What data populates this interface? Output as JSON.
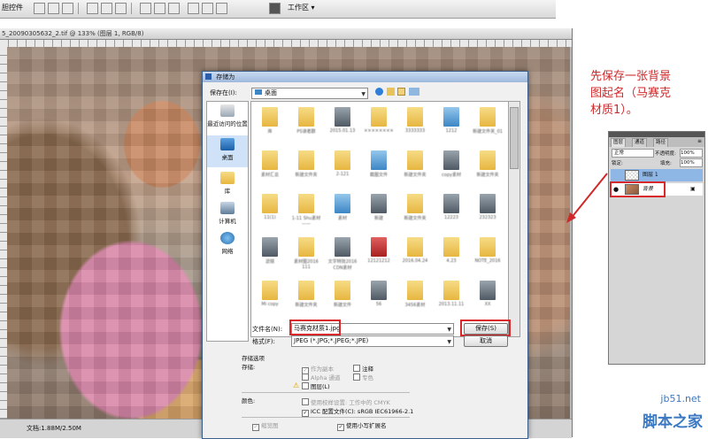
{
  "optbar": {
    "left_label": "胆控件",
    "workspace": "工作区 ▾"
  },
  "document": {
    "title": "5_20090305632_2.tif @ 133% (图层 1, RGB/8)",
    "status": "文档:1.88M/2.50M"
  },
  "dialog": {
    "title": "存储为",
    "save_in_label": "保存在(I):",
    "save_in_value": "桌面",
    "places": [
      {
        "label": "最近访问的位置",
        "icon": "recent-icon"
      },
      {
        "label": "桌面",
        "icon": "desktop-icon"
      },
      {
        "label": "库",
        "icon": "library-icon"
      },
      {
        "label": "计算机",
        "icon": "computer-icon"
      },
      {
        "label": "网络",
        "icon": "network-icon"
      }
    ],
    "files": [
      {
        "label": "库",
        "kind": "folder"
      },
      {
        "label": "PS读者群",
        "kind": "folder"
      },
      {
        "label": "2015.01.13",
        "kind": "doc"
      },
      {
        "label": "××××××××",
        "kind": "folder"
      },
      {
        "label": "3333333",
        "kind": "folder"
      },
      {
        "label": "1212",
        "kind": "blue"
      },
      {
        "label": "新建文件夹_01",
        "kind": "folder"
      },
      {
        "label": "素材汇总",
        "kind": "folder"
      },
      {
        "label": "新建文件夹",
        "kind": "folder"
      },
      {
        "label": "2-121",
        "kind": "folder"
      },
      {
        "label": "截图文件",
        "kind": "blue"
      },
      {
        "label": "新建文件夹",
        "kind": "folder"
      },
      {
        "label": "copy素材",
        "kind": "doc"
      },
      {
        "label": "新建文件夹",
        "kind": "folder"
      },
      {
        "label": "11(1)",
        "kind": "folder"
      },
      {
        "label": "1-11 Shu素材——",
        "kind": "folder"
      },
      {
        "label": "素材",
        "kind": "blue"
      },
      {
        "label": "新建",
        "kind": "doc"
      },
      {
        "label": "新建文件夹",
        "kind": "folder"
      },
      {
        "label": "12223",
        "kind": "doc"
      },
      {
        "label": "232323",
        "kind": "doc"
      },
      {
        "label": "滤镜",
        "kind": "doc"
      },
      {
        "label": "素材图2016 111",
        "kind": "folder"
      },
      {
        "label": "文字特效2016 CDN素材",
        "kind": "doc"
      },
      {
        "label": "12121212",
        "kind": "red"
      },
      {
        "label": "2016.04.24",
        "kind": "folder"
      },
      {
        "label": "4.23",
        "kind": "folder"
      },
      {
        "label": "NOTE_2016",
        "kind": "folder"
      },
      {
        "label": "Mi copy",
        "kind": "folder"
      },
      {
        "label": "新建文件夹",
        "kind": "folder"
      },
      {
        "label": "新建文件",
        "kind": "folder"
      },
      {
        "label": "56",
        "kind": "doc"
      },
      {
        "label": "3456素材",
        "kind": "folder"
      },
      {
        "label": "2013.11.11",
        "kind": "folder"
      },
      {
        "label": "XX",
        "kind": "doc"
      }
    ],
    "filename_label": "文件名(N):",
    "filename_value": "马赛克材质1.jpg",
    "format_label": "格式(F):",
    "format_value": "JPEG (*.JPG;*.JPEG;*.JPE)",
    "save_button": "保存(S)",
    "cancel_button": "取消",
    "options": {
      "heading": "存储选项",
      "store_label": "存储:",
      "as_copy": "作为副本",
      "notes": "注释",
      "alpha": "Alpha 通道",
      "spot": "专色",
      "layers": "图层(L)",
      "color_label": "颜色:",
      "proof": "使用校样设置: 工作中的 CMYK",
      "icc": "ICC 配置文件(C): sRGB IEC61966-2.1",
      "thumbnail": "缩览图",
      "lowercase": "使用小写扩展名"
    }
  },
  "annotation": {
    "lines": [
      "先保存一张背景",
      "图起名（马赛克",
      "材质1）。"
    ],
    "color": "#d0282a"
  },
  "layers_panel": {
    "tabs": [
      "图层",
      "通道",
      "路径"
    ],
    "blend_mode": "正常",
    "opacity_label": "不透明度:",
    "opacity_value": "100%",
    "lock_label": "锁定:",
    "fill_label": "填充:",
    "fill_value": "100%",
    "layers": [
      {
        "name": "图层 1",
        "selected": true
      },
      {
        "name": "背景",
        "selected": false
      }
    ]
  },
  "watermark": {
    "site": "jb51.net",
    "name": "脚本之家"
  }
}
